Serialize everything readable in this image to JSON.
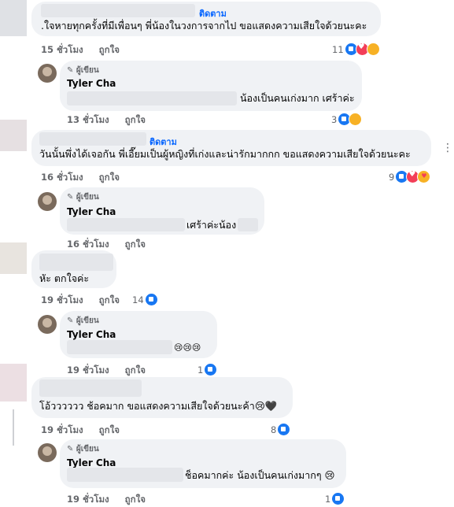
{
  "ui": {
    "follow": "ติดตาม",
    "like": "ถูกใจ",
    "author_badge": "ผู้เขียน",
    "more_symbol": "⋮"
  },
  "comments": [
    {
      "text": ".ใจหายทุกครั้งที่มีเพื่อนๆ พี่น้องในวงการจากไป ขอแสดงความเสียใจด้วยนะคะ",
      "time": "15 ชั่วโมง",
      "react_count": "11",
      "reactions": [
        "like",
        "love",
        "sad"
      ]
    },
    {
      "name": "Tyler Cha",
      "text": "น้องเป็นคนเก่งมาก เศร้าค่ะ",
      "time": "13 ชั่วโมง",
      "react_count": "3",
      "reactions": [
        "like",
        "sad"
      ]
    },
    {
      "text": "วันนั้นพึ่งได้เจอกัน พี่เอี๊ยมเป็นผู้หญิงที่เก่งและน่ารักมากกก ขอแสดงความเสียใจด้วยนะคะ",
      "time": "16 ชั่วโมง",
      "react_count": "9",
      "reactions": [
        "like",
        "love",
        "care"
      ]
    },
    {
      "name": "Tyler Cha",
      "text": "เศร้าค่ะน้อง",
      "time": "16 ชั่วโมง"
    },
    {
      "text": "หัะ ตกใจค่ะ",
      "time": "19 ชั่วโมง",
      "react_count": "14",
      "reactions": [
        "like"
      ]
    },
    {
      "name": "Tyler Cha",
      "text": "😢😢😢",
      "time": "19 ชั่วโมง",
      "react_count": "1",
      "reactions": [
        "like"
      ]
    },
    {
      "text": "โอ้วววววว ช้อคมาก ขอแสดงความเสียใจด้วยนะค้า😢🖤",
      "time": "19 ชั่วโมง",
      "react_count": "8",
      "reactions": [
        "like"
      ]
    },
    {
      "name": "Tyler Cha",
      "text": "ช็อคมากค่ะ น้องเป็นคนเก่งมากๆ 😢",
      "time": "19 ชั่วโมง",
      "react_count": "1",
      "reactions": [
        "like"
      ]
    }
  ]
}
